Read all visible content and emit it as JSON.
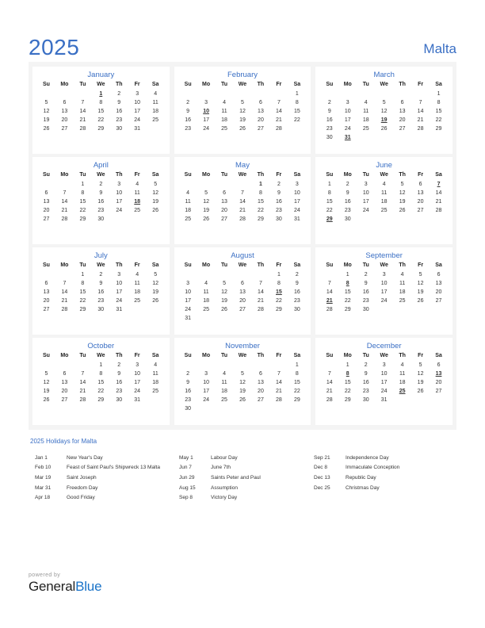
{
  "header": {
    "year": "2025",
    "country": "Malta"
  },
  "weekdays": [
    "Su",
    "Mo",
    "Tu",
    "We",
    "Th",
    "Fr",
    "Sa"
  ],
  "months": [
    {
      "name": "January",
      "weeks": [
        [
          "",
          "",
          "",
          "1",
          "2",
          "3",
          "4"
        ],
        [
          "5",
          "6",
          "7",
          "8",
          "9",
          "10",
          "11"
        ],
        [
          "12",
          "13",
          "14",
          "15",
          "16",
          "17",
          "18"
        ],
        [
          "19",
          "20",
          "21",
          "22",
          "23",
          "24",
          "25"
        ],
        [
          "26",
          "27",
          "28",
          "29",
          "30",
          "31",
          ""
        ],
        [
          "",
          "",
          "",
          "",
          "",
          "",
          ""
        ]
      ],
      "holidays": [
        "1"
      ]
    },
    {
      "name": "February",
      "weeks": [
        [
          "",
          "",
          "",
          "",
          "",
          "",
          "1"
        ],
        [
          "2",
          "3",
          "4",
          "5",
          "6",
          "7",
          "8"
        ],
        [
          "9",
          "10",
          "11",
          "12",
          "13",
          "14",
          "15"
        ],
        [
          "16",
          "17",
          "18",
          "19",
          "20",
          "21",
          "22"
        ],
        [
          "23",
          "24",
          "25",
          "26",
          "27",
          "28",
          ""
        ],
        [
          "",
          "",
          "",
          "",
          "",
          "",
          ""
        ]
      ],
      "holidays": [
        "10"
      ]
    },
    {
      "name": "March",
      "weeks": [
        [
          "",
          "",
          "",
          "",
          "",
          "",
          "1"
        ],
        [
          "2",
          "3",
          "4",
          "5",
          "6",
          "7",
          "8"
        ],
        [
          "9",
          "10",
          "11",
          "12",
          "13",
          "14",
          "15"
        ],
        [
          "16",
          "17",
          "18",
          "19",
          "20",
          "21",
          "22"
        ],
        [
          "23",
          "24",
          "25",
          "26",
          "27",
          "28",
          "29"
        ],
        [
          "30",
          "31",
          "",
          "",
          "",
          "",
          ""
        ]
      ],
      "holidays": [
        "19",
        "31"
      ]
    },
    {
      "name": "April",
      "weeks": [
        [
          "",
          "",
          "1",
          "2",
          "3",
          "4",
          "5"
        ],
        [
          "6",
          "7",
          "8",
          "9",
          "10",
          "11",
          "12"
        ],
        [
          "13",
          "14",
          "15",
          "16",
          "17",
          "18",
          "19"
        ],
        [
          "20",
          "21",
          "22",
          "23",
          "24",
          "25",
          "26"
        ],
        [
          "27",
          "28",
          "29",
          "30",
          "",
          "",
          ""
        ],
        [
          "",
          "",
          "",
          "",
          "",
          "",
          ""
        ]
      ],
      "holidays": [
        "18"
      ]
    },
    {
      "name": "May",
      "weeks": [
        [
          "",
          "",
          "",
          "",
          "1",
          "2",
          "3"
        ],
        [
          "4",
          "5",
          "6",
          "7",
          "8",
          "9",
          "10"
        ],
        [
          "11",
          "12",
          "13",
          "14",
          "15",
          "16",
          "17"
        ],
        [
          "18",
          "19",
          "20",
          "21",
          "22",
          "23",
          "24"
        ],
        [
          "25",
          "26",
          "27",
          "28",
          "29",
          "30",
          "31"
        ],
        [
          "",
          "",
          "",
          "",
          "",
          "",
          ""
        ]
      ],
      "holidays": [
        "1"
      ],
      "holidays_no_underline": [
        "1"
      ]
    },
    {
      "name": "June",
      "weeks": [
        [
          "1",
          "2",
          "3",
          "4",
          "5",
          "6",
          "7"
        ],
        [
          "8",
          "9",
          "10",
          "11",
          "12",
          "13",
          "14"
        ],
        [
          "15",
          "16",
          "17",
          "18",
          "19",
          "20",
          "21"
        ],
        [
          "22",
          "23",
          "24",
          "25",
          "26",
          "27",
          "28"
        ],
        [
          "29",
          "30",
          "",
          "",
          "",
          "",
          ""
        ],
        [
          "",
          "",
          "",
          "",
          "",
          "",
          ""
        ]
      ],
      "holidays": [
        "7",
        "29"
      ]
    },
    {
      "name": "July",
      "weeks": [
        [
          "",
          "",
          "1",
          "2",
          "3",
          "4",
          "5"
        ],
        [
          "6",
          "7",
          "8",
          "9",
          "10",
          "11",
          "12"
        ],
        [
          "13",
          "14",
          "15",
          "16",
          "17",
          "18",
          "19"
        ],
        [
          "20",
          "21",
          "22",
          "23",
          "24",
          "25",
          "26"
        ],
        [
          "27",
          "28",
          "29",
          "30",
          "31",
          "",
          ""
        ],
        [
          "",
          "",
          "",
          "",
          "",
          "",
          ""
        ]
      ],
      "holidays": []
    },
    {
      "name": "August",
      "weeks": [
        [
          "",
          "",
          "",
          "",
          "",
          "1",
          "2"
        ],
        [
          "3",
          "4",
          "5",
          "6",
          "7",
          "8",
          "9"
        ],
        [
          "10",
          "11",
          "12",
          "13",
          "14",
          "15",
          "16"
        ],
        [
          "17",
          "18",
          "19",
          "20",
          "21",
          "22",
          "23"
        ],
        [
          "24",
          "25",
          "26",
          "27",
          "28",
          "29",
          "30"
        ],
        [
          "31",
          "",
          "",
          "",
          "",
          "",
          ""
        ]
      ],
      "holidays": [
        "15"
      ]
    },
    {
      "name": "September",
      "weeks": [
        [
          "",
          "1",
          "2",
          "3",
          "4",
          "5",
          "6"
        ],
        [
          "7",
          "8",
          "9",
          "10",
          "11",
          "12",
          "13"
        ],
        [
          "14",
          "15",
          "16",
          "17",
          "18",
          "19",
          "20"
        ],
        [
          "21",
          "22",
          "23",
          "24",
          "25",
          "26",
          "27"
        ],
        [
          "28",
          "29",
          "30",
          "",
          "",
          "",
          ""
        ],
        [
          "",
          "",
          "",
          "",
          "",
          "",
          ""
        ]
      ],
      "holidays": [
        "8",
        "21"
      ]
    },
    {
      "name": "October",
      "weeks": [
        [
          "",
          "",
          "",
          "1",
          "2",
          "3",
          "4"
        ],
        [
          "5",
          "6",
          "7",
          "8",
          "9",
          "10",
          "11"
        ],
        [
          "12",
          "13",
          "14",
          "15",
          "16",
          "17",
          "18"
        ],
        [
          "19",
          "20",
          "21",
          "22",
          "23",
          "24",
          "25"
        ],
        [
          "26",
          "27",
          "28",
          "29",
          "30",
          "31",
          ""
        ],
        [
          "",
          "",
          "",
          "",
          "",
          "",
          ""
        ]
      ],
      "holidays": []
    },
    {
      "name": "November",
      "weeks": [
        [
          "",
          "",
          "",
          "",
          "",
          "",
          "1"
        ],
        [
          "2",
          "3",
          "4",
          "5",
          "6",
          "7",
          "8"
        ],
        [
          "9",
          "10",
          "11",
          "12",
          "13",
          "14",
          "15"
        ],
        [
          "16",
          "17",
          "18",
          "19",
          "20",
          "21",
          "22"
        ],
        [
          "23",
          "24",
          "25",
          "26",
          "27",
          "28",
          "29"
        ],
        [
          "30",
          "",
          "",
          "",
          "",
          "",
          ""
        ]
      ],
      "holidays": []
    },
    {
      "name": "December",
      "weeks": [
        [
          "",
          "1",
          "2",
          "3",
          "4",
          "5",
          "6"
        ],
        [
          "7",
          "8",
          "9",
          "10",
          "11",
          "12",
          "13"
        ],
        [
          "14",
          "15",
          "16",
          "17",
          "18",
          "19",
          "20"
        ],
        [
          "21",
          "22",
          "23",
          "24",
          "25",
          "26",
          "27"
        ],
        [
          "28",
          "29",
          "30",
          "31",
          "",
          "",
          ""
        ],
        [
          "",
          "",
          "",
          "",
          "",
          "",
          ""
        ]
      ],
      "holidays": [
        "8",
        "13",
        "25"
      ]
    }
  ],
  "holidays_section": {
    "title": "2025 Holidays for Malta",
    "columns": [
      [
        {
          "date": "Jan 1",
          "name": "New Year's Day"
        },
        {
          "date": "Feb 10",
          "name": "Feast of Saint Paul's Shipwreck 13 Malta"
        },
        {
          "date": "Mar 19",
          "name": "Saint Joseph"
        },
        {
          "date": "Mar 31",
          "name": "Freedom Day"
        },
        {
          "date": "Apr 18",
          "name": "Good Friday"
        }
      ],
      [
        {
          "date": "May 1",
          "name": "Labour Day"
        },
        {
          "date": "Jun 7",
          "name": "June 7th"
        },
        {
          "date": "Jun 29",
          "name": "Saints Peter and Paul"
        },
        {
          "date": "Aug 15",
          "name": "Assumption"
        },
        {
          "date": "Sep 8",
          "name": "Victory Day"
        }
      ],
      [
        {
          "date": "Sep 21",
          "name": "Independence Day"
        },
        {
          "date": "Dec 8",
          "name": "Immaculate Conception"
        },
        {
          "date": "Dec 13",
          "name": "Republic Day"
        },
        {
          "date": "Dec 25",
          "name": "Christmas Day"
        }
      ]
    ]
  },
  "footer": {
    "powered_by": "powered by",
    "brand_first": "General",
    "brand_second": "Blue"
  },
  "colors": {
    "accent_blue": "#3a6fc4",
    "holiday_red": "#e00000",
    "panel_bg": "#f4f4f4",
    "brand_blue": "#1a73c8"
  }
}
